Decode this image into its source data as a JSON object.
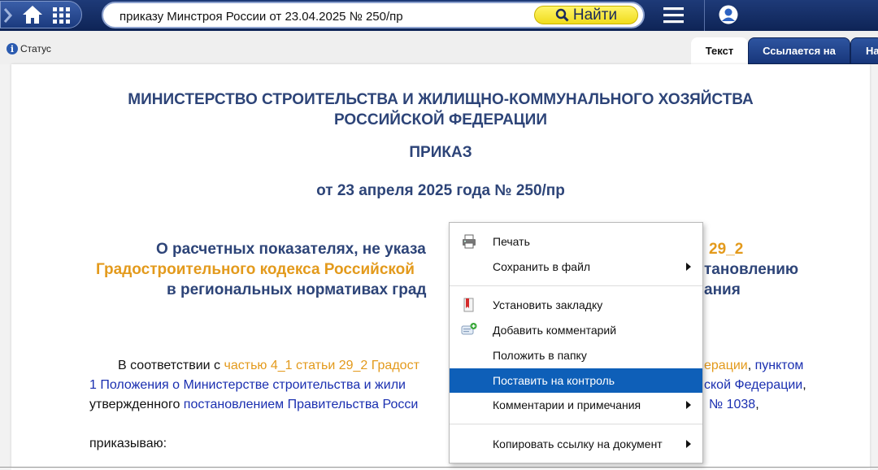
{
  "search": {
    "value": "приказу Минстроя России от 23.04.2025 № 250/пр",
    "find_label": "Найти"
  },
  "status": {
    "label": "Статус"
  },
  "tabs": {
    "text": "Текст",
    "refs": "Ссылается на",
    "more": "На"
  },
  "document": {
    "ministry_line1": "МИНИСТЕРСТВО СТРОИТЕЛЬСТВА И ЖИЛИЩНО-КОММУНАЛЬНОГО ХОЗЯЙСТВА",
    "ministry_line2": "РОССИЙСКОЙ ФЕДЕРАЦИИ",
    "doc_type": "ПРИКАЗ",
    "date_line": "от 23 апреля 2025 года № 250/пр",
    "title_line1_a": "О расчетных показателях, не указа",
    "title_line1_b": "29_2",
    "title_line2_a": "Градостроительного кодекса Российской",
    "title_line2_b": "тановлению",
    "title_line3_a": "в региональных нормативах град",
    "title_line3_b": "ания",
    "para_1": "В соответствии с ",
    "para_link1": "частью 4_1 статьи 29_2 Градост",
    "para_link1b": "ерации",
    "para_comma1": ", ",
    "para_link2": "пунктом",
    "para_link2b": "1 Положения о Министерстве строительства и жили",
    "para_link2c": "ской Федерации",
    "para_comma2": ",",
    "para_3": "утвержденного ",
    "para_link3": "постановлением Правительства Росси",
    "para_link3b": "№ 1038",
    "para_end": ",",
    "order_word": "приказываю:"
  },
  "context_menu": {
    "print": "Печать",
    "save_to_file": "Сохранить в файл",
    "set_bookmark": "Установить закладку",
    "add_comment": "Добавить комментарий",
    "put_to_folder": "Положить в папку",
    "set_control": "Поставить на контроль",
    "comments_notes": "Комментарии и примечания",
    "copy_link": "Копировать ссылку на документ"
  },
  "colors": {
    "topbar": "#0e2456",
    "accent": "#2d4478",
    "highlight": "#0e5fb8",
    "link_orange": "#e39a1c",
    "find_button": "#f7e93a"
  }
}
